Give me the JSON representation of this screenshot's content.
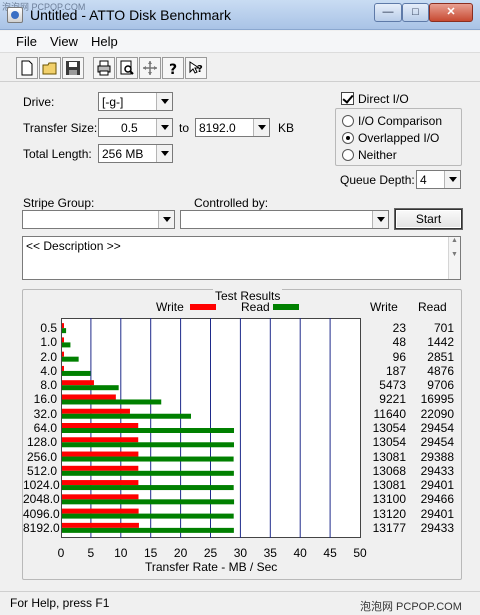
{
  "watermark_top": "泡泡网 PCPOP.COM",
  "window": {
    "title": "Untitled - ATTO Disk Benchmark",
    "min": "—",
    "max": "□",
    "close": "✕"
  },
  "menu": [
    "File",
    "View",
    "Help"
  ],
  "toolbar_icons": [
    "new-file-icon",
    "open-folder-icon",
    "save-icon",
    "print-icon",
    "print-preview-icon",
    "move-icon",
    "help-icon",
    "context-help-icon"
  ],
  "form": {
    "drive_label": "Drive:",
    "drive_value": "[-g-]",
    "transfer_size_label": "Transfer Size:",
    "transfer_from": "0.5",
    "to_label": "to",
    "transfer_to": "8192.0",
    "kb_label": "KB",
    "total_length_label": "Total Length:",
    "total_length_value": "256 MB",
    "direct_io_label": "Direct I/O",
    "radio_io_comparison": "I/O Comparison",
    "radio_overlapped": "Overlapped I/O",
    "radio_neither": "Neither",
    "queue_depth_label": "Queue Depth:",
    "queue_depth_value": "4",
    "stripe_group_label": "Stripe Group:",
    "controlled_by_label": "Controlled by:",
    "start_label": "Start",
    "description": "<< Description >>"
  },
  "chart_data": {
    "type": "bar",
    "title": "Test Results",
    "xlabel": "Transfer Rate - MB / Sec",
    "ylabel": "",
    "xlim": [
      0,
      50
    ],
    "xticks": [
      "0",
      "5",
      "10",
      "15",
      "20",
      "25",
      "30",
      "35",
      "40",
      "45",
      "50"
    ],
    "categories": [
      "0.5",
      "1.0",
      "2.0",
      "4.0",
      "8.0",
      "16.0",
      "32.0",
      "64.0",
      "128.0",
      "256.0",
      "512.0",
      "1024.0",
      "2048.0",
      "4096.0",
      "8192.0"
    ],
    "series": [
      {
        "name": "Write",
        "color": "#ff0000",
        "values_kbps": [
          23,
          48,
          96,
          187,
          5473,
          9221,
          11640,
          13054,
          13054,
          13081,
          13068,
          13081,
          13100,
          13120,
          13177
        ]
      },
      {
        "name": "Read",
        "color": "#008000",
        "values_kbps": [
          701,
          1442,
          2851,
          4876,
          9706,
          16995,
          22090,
          29454,
          29454,
          29388,
          29433,
          29401,
          29466,
          29401,
          29433
        ]
      }
    ],
    "col_write_head": "Write",
    "col_read_head": "Read",
    "grid": true,
    "legend": "top"
  },
  "status": {
    "text": "For Help, press F1",
    "watermark": "泡泡网 PCPOP.COM"
  }
}
